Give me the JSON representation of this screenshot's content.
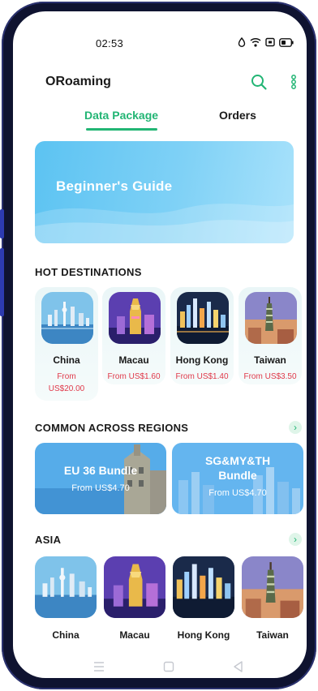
{
  "status_bar": {
    "time": "02:53",
    "icons": [
      "notification-icon",
      "wifi-icon",
      "sim-icon",
      "battery-icon"
    ]
  },
  "app": {
    "title": "ORoaming",
    "accent": "#22b574",
    "price_color": "#e0394a"
  },
  "tabs": [
    {
      "label": "Data Package",
      "active": true
    },
    {
      "label": "Orders",
      "active": false
    }
  ],
  "banner": {
    "text": "Beginner's Guide"
  },
  "hot_destinations": {
    "title": "HOT DESTINATIONS",
    "items": [
      {
        "name": "China",
        "price_line1": "From",
        "price_line2": "US$20.00"
      },
      {
        "name": "Macau",
        "price": "From US$1.60"
      },
      {
        "name": "Hong Kong",
        "price": "From US$1.40"
      },
      {
        "name": "Taiwan",
        "price": "From US$3.50"
      }
    ]
  },
  "common": {
    "title": "COMMON ACROSS REGIONS",
    "bundles": [
      {
        "title": "EU 36 Bundle",
        "price": "From US$4.70"
      },
      {
        "title_line1": "SG&MY&TH",
        "title_line2": "Bundle",
        "price": "From US$4.70"
      }
    ]
  },
  "asia": {
    "title": "ASIA",
    "items": [
      {
        "name": "China"
      },
      {
        "name": "Macau"
      },
      {
        "name": "Hong Kong"
      },
      {
        "name": "Taiwan"
      }
    ]
  },
  "nav_bar": [
    "menu-icon",
    "home-icon",
    "back-icon"
  ]
}
